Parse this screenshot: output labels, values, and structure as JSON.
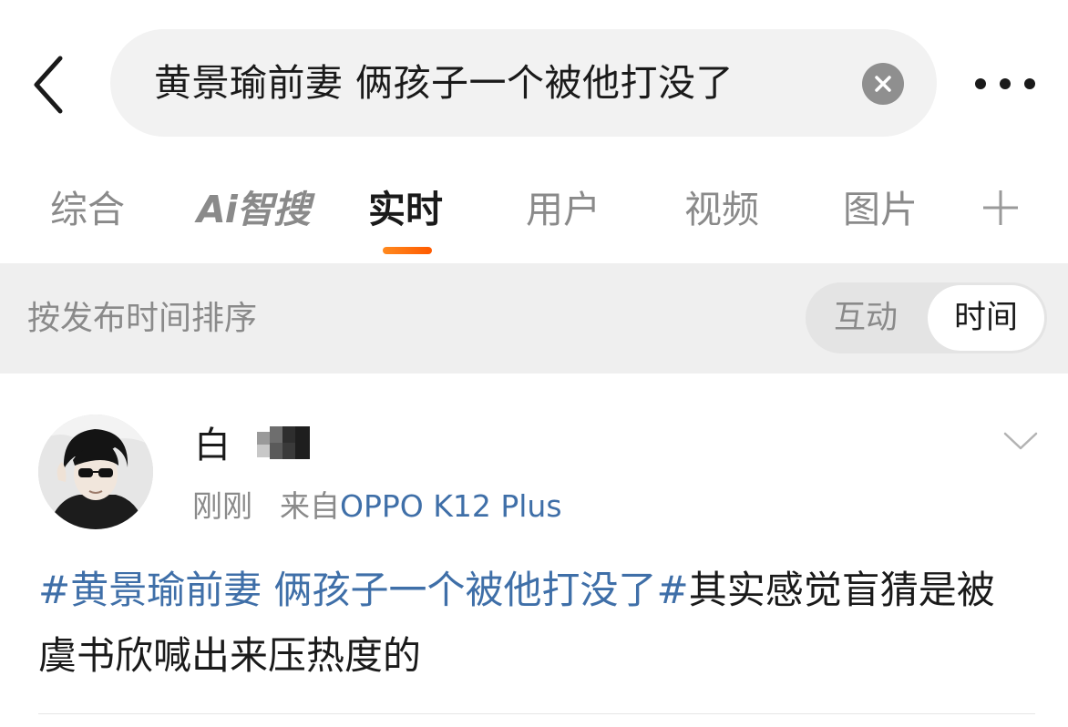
{
  "search": {
    "query": "黄景瑜前妻 俩孩子一个被他打没了"
  },
  "icons": {
    "back": "chevron-left-icon",
    "clear": "clear-icon",
    "more": "more-horizontal-icon",
    "add": "plus-icon",
    "expand": "chevron-down-icon"
  },
  "tabs": [
    {
      "label": "综合"
    },
    {
      "label": "Ai智搜"
    },
    {
      "label": "实时",
      "active": true
    },
    {
      "label": "用户"
    },
    {
      "label": "视频"
    },
    {
      "label": "图片"
    }
  ],
  "sort": {
    "label": "按发布时间排序",
    "options": [
      "互动",
      "时间"
    ],
    "selected": "时间"
  },
  "post": {
    "username": "白",
    "time": "刚刚",
    "source_prefix": "来自",
    "device": "OPPO K12 Plus",
    "hashtag": "#黄景瑜前妻 俩孩子一个被他打没了#",
    "text": "其实感觉盲猜是被虞书欣喊出来压热度的"
  },
  "colors": {
    "accent": "#ff6a00",
    "link": "#3f6fa8",
    "background": "#ffffff",
    "sort_bar_bg": "#efefef"
  }
}
